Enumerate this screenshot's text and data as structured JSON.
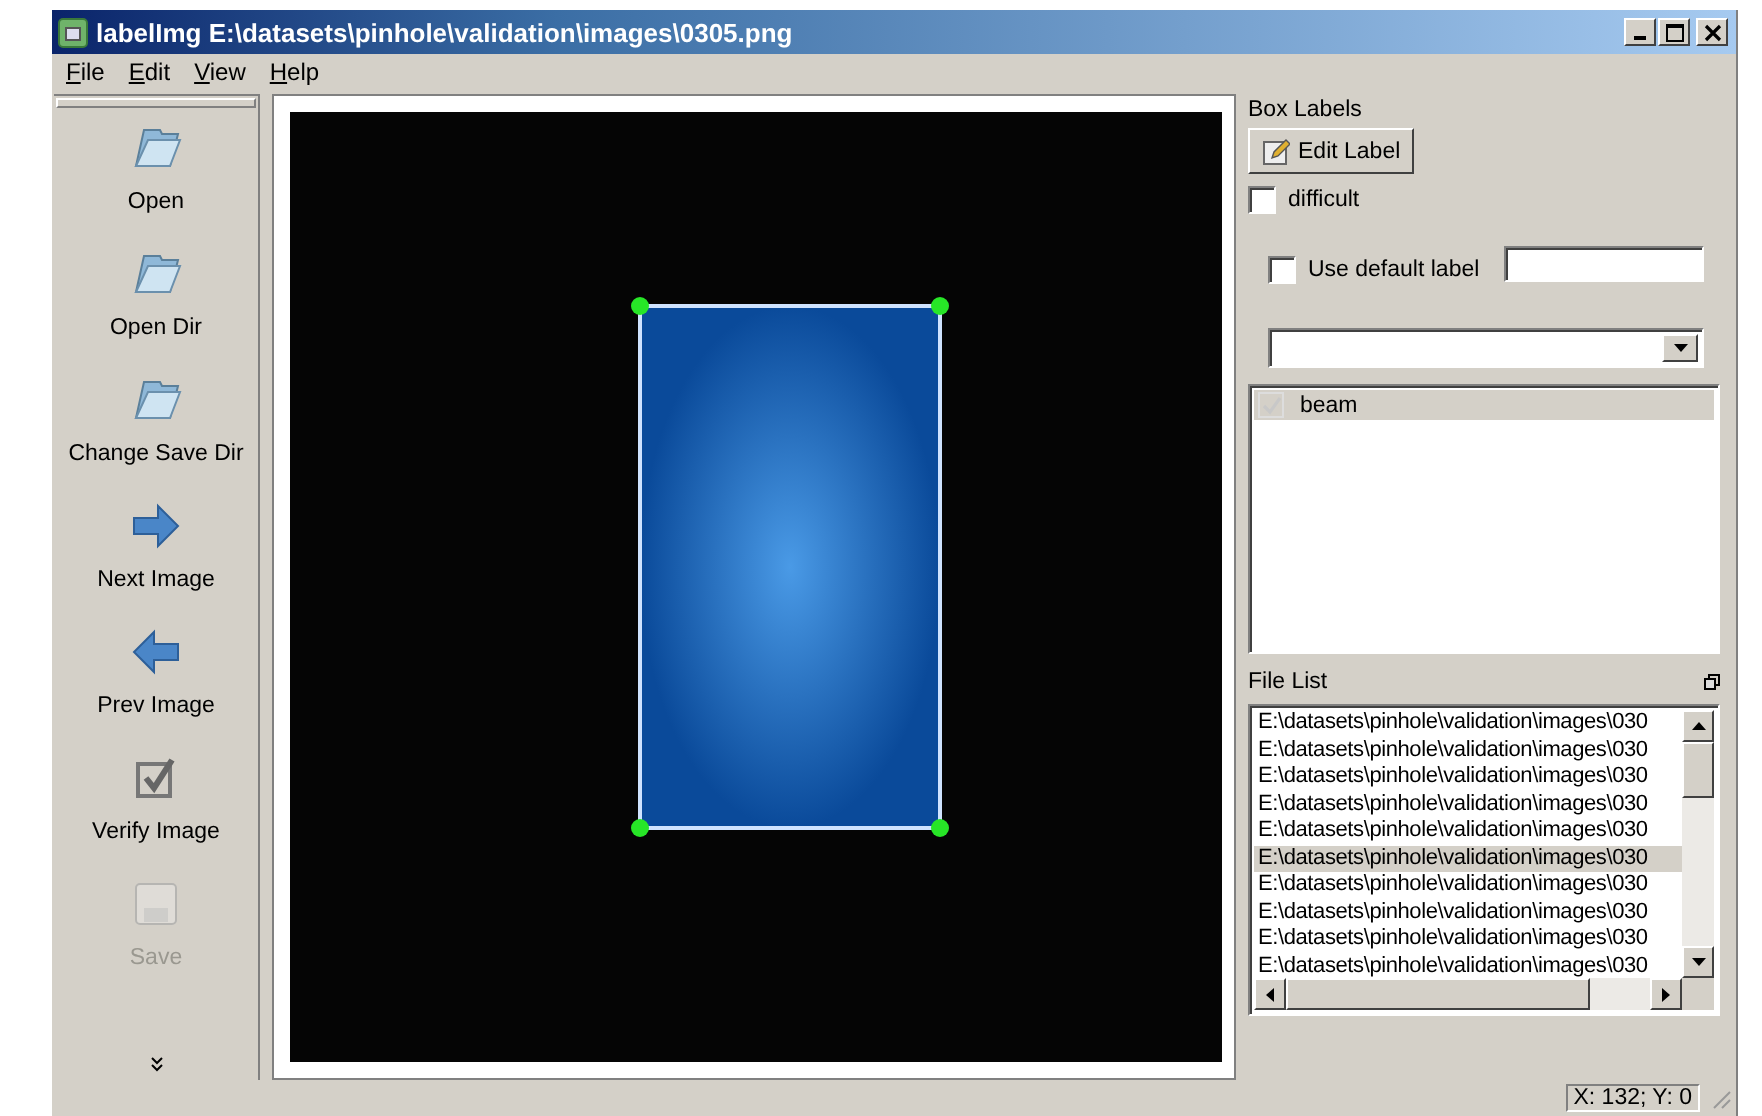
{
  "window": {
    "title": "labelImg E:\\datasets\\pinhole\\validation\\images\\0305.png"
  },
  "menu": [
    "File",
    "Edit",
    "View",
    "Help"
  ],
  "toolbar": [
    {
      "label": "Open",
      "kind": "folder",
      "disabled": false
    },
    {
      "label": "Open Dir",
      "kind": "folder",
      "disabled": false
    },
    {
      "label": "Change Save Dir",
      "kind": "folder",
      "disabled": false
    },
    {
      "label": "Next Image",
      "kind": "next",
      "disabled": false
    },
    {
      "label": "Prev Image",
      "kind": "prev",
      "disabled": false
    },
    {
      "label": "Verify Image",
      "kind": "verify",
      "disabled": false
    },
    {
      "label": "Save",
      "kind": "save",
      "disabled": true
    }
  ],
  "box_labels": {
    "title": "Box Labels",
    "edit_button": "Edit Label",
    "difficult": {
      "label": "difficult",
      "checked": false
    },
    "use_default": {
      "label": "Use default label",
      "checked": false
    },
    "labels": [
      {
        "name": "beam",
        "checked": true,
        "selected": true
      }
    ]
  },
  "file_list": {
    "title": "File List",
    "items": [
      {
        "path": "E:\\datasets\\pinhole\\validation\\images\\030",
        "selected": false
      },
      {
        "path": "E:\\datasets\\pinhole\\validation\\images\\030",
        "selected": false
      },
      {
        "path": "E:\\datasets\\pinhole\\validation\\images\\030",
        "selected": false
      },
      {
        "path": "E:\\datasets\\pinhole\\validation\\images\\030",
        "selected": false
      },
      {
        "path": "E:\\datasets\\pinhole\\validation\\images\\030",
        "selected": false
      },
      {
        "path": "E:\\datasets\\pinhole\\validation\\images\\030",
        "selected": true
      },
      {
        "path": "E:\\datasets\\pinhole\\validation\\images\\030",
        "selected": false
      },
      {
        "path": "E:\\datasets\\pinhole\\validation\\images\\030",
        "selected": false
      },
      {
        "path": "E:\\datasets\\pinhole\\validation\\images\\030",
        "selected": false
      },
      {
        "path": "E:\\datasets\\pinhole\\validation\\images\\030",
        "selected": false
      }
    ]
  },
  "status_bar": {
    "coords": "X: 132; Y: 0"
  }
}
